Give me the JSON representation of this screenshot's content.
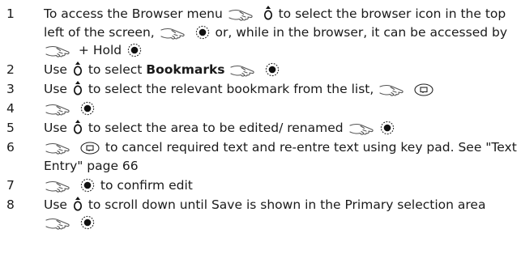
{
  "steps": [
    {
      "number": "1",
      "parts": [
        {
          "t": "text",
          "v": "To access the Browser menu "
        },
        {
          "t": "icon",
          "v": "press-hand-icon"
        },
        {
          "t": "text",
          "v": " "
        },
        {
          "t": "icon",
          "v": "navigation-key-icon"
        },
        {
          "t": "text",
          "v": " to select the browser icon in the top left of the screen, "
        },
        {
          "t": "icon",
          "v": "press-hand-icon"
        },
        {
          "t": "text",
          "v": " "
        },
        {
          "t": "icon",
          "v": "select-key-icon"
        },
        {
          "t": "text",
          "v": " or, while in the browser, it can be accessed by "
        },
        {
          "t": "icon",
          "v": "press-hand-icon"
        },
        {
          "t": "text",
          "v": " + Hold "
        },
        {
          "t": "icon",
          "v": "select-key-icon"
        }
      ]
    },
    {
      "number": "2",
      "parts": [
        {
          "t": "text",
          "v": "Use "
        },
        {
          "t": "icon",
          "v": "navigation-key-icon"
        },
        {
          "t": "text",
          "v": " to select "
        },
        {
          "t": "bold",
          "v": "Bookmarks"
        },
        {
          "t": "text",
          "v": " "
        },
        {
          "t": "icon",
          "v": "press-hand-icon"
        },
        {
          "t": "text",
          "v": " "
        },
        {
          "t": "icon",
          "v": "select-key-icon"
        }
      ]
    },
    {
      "number": "3",
      "parts": [
        {
          "t": "text",
          "v": "Use "
        },
        {
          "t": "icon",
          "v": "navigation-key-icon"
        },
        {
          "t": "text",
          "v": " to select the relevant bookmark from the list, "
        },
        {
          "t": "icon",
          "v": "press-hand-icon"
        },
        {
          "t": "text",
          "v": " "
        },
        {
          "t": "icon",
          "v": "softkey-icon"
        }
      ]
    },
    {
      "number": "4",
      "parts": [
        {
          "t": "icon",
          "v": "press-hand-icon"
        },
        {
          "t": "text",
          "v": " "
        },
        {
          "t": "icon",
          "v": "select-key-icon"
        }
      ]
    },
    {
      "number": "5",
      "parts": [
        {
          "t": "text",
          "v": "Use "
        },
        {
          "t": "icon",
          "v": "navigation-key-icon"
        },
        {
          "t": "text",
          "v": " to select the area to be edited/ renamed "
        },
        {
          "t": "icon",
          "v": "press-hand-icon"
        },
        {
          "t": "icon",
          "v": "select-key-icon"
        }
      ]
    },
    {
      "number": "6",
      "parts": [
        {
          "t": "icon",
          "v": "press-hand-icon"
        },
        {
          "t": "text",
          "v": " "
        },
        {
          "t": "icon",
          "v": "softkey-icon"
        },
        {
          "t": "text",
          "v": " to cancel required text and re-entre text using key pad. See \"Text Entry\" page 66"
        }
      ]
    },
    {
      "number": "7",
      "parts": [
        {
          "t": "icon",
          "v": "press-hand-icon"
        },
        {
          "t": "text",
          "v": " "
        },
        {
          "t": "icon",
          "v": "select-key-icon"
        },
        {
          "t": "text",
          "v": " to confirm edit"
        }
      ]
    },
    {
      "number": "8",
      "parts": [
        {
          "t": "text",
          "v": "Use "
        },
        {
          "t": "icon",
          "v": "navigation-key-icon"
        },
        {
          "t": "text",
          "v": " to scroll down until Save is shown in the Primary selection area "
        },
        {
          "t": "icon",
          "v": "press-hand-icon"
        },
        {
          "t": "text",
          "v": " "
        },
        {
          "t": "icon",
          "v": "select-key-icon"
        }
      ]
    }
  ]
}
